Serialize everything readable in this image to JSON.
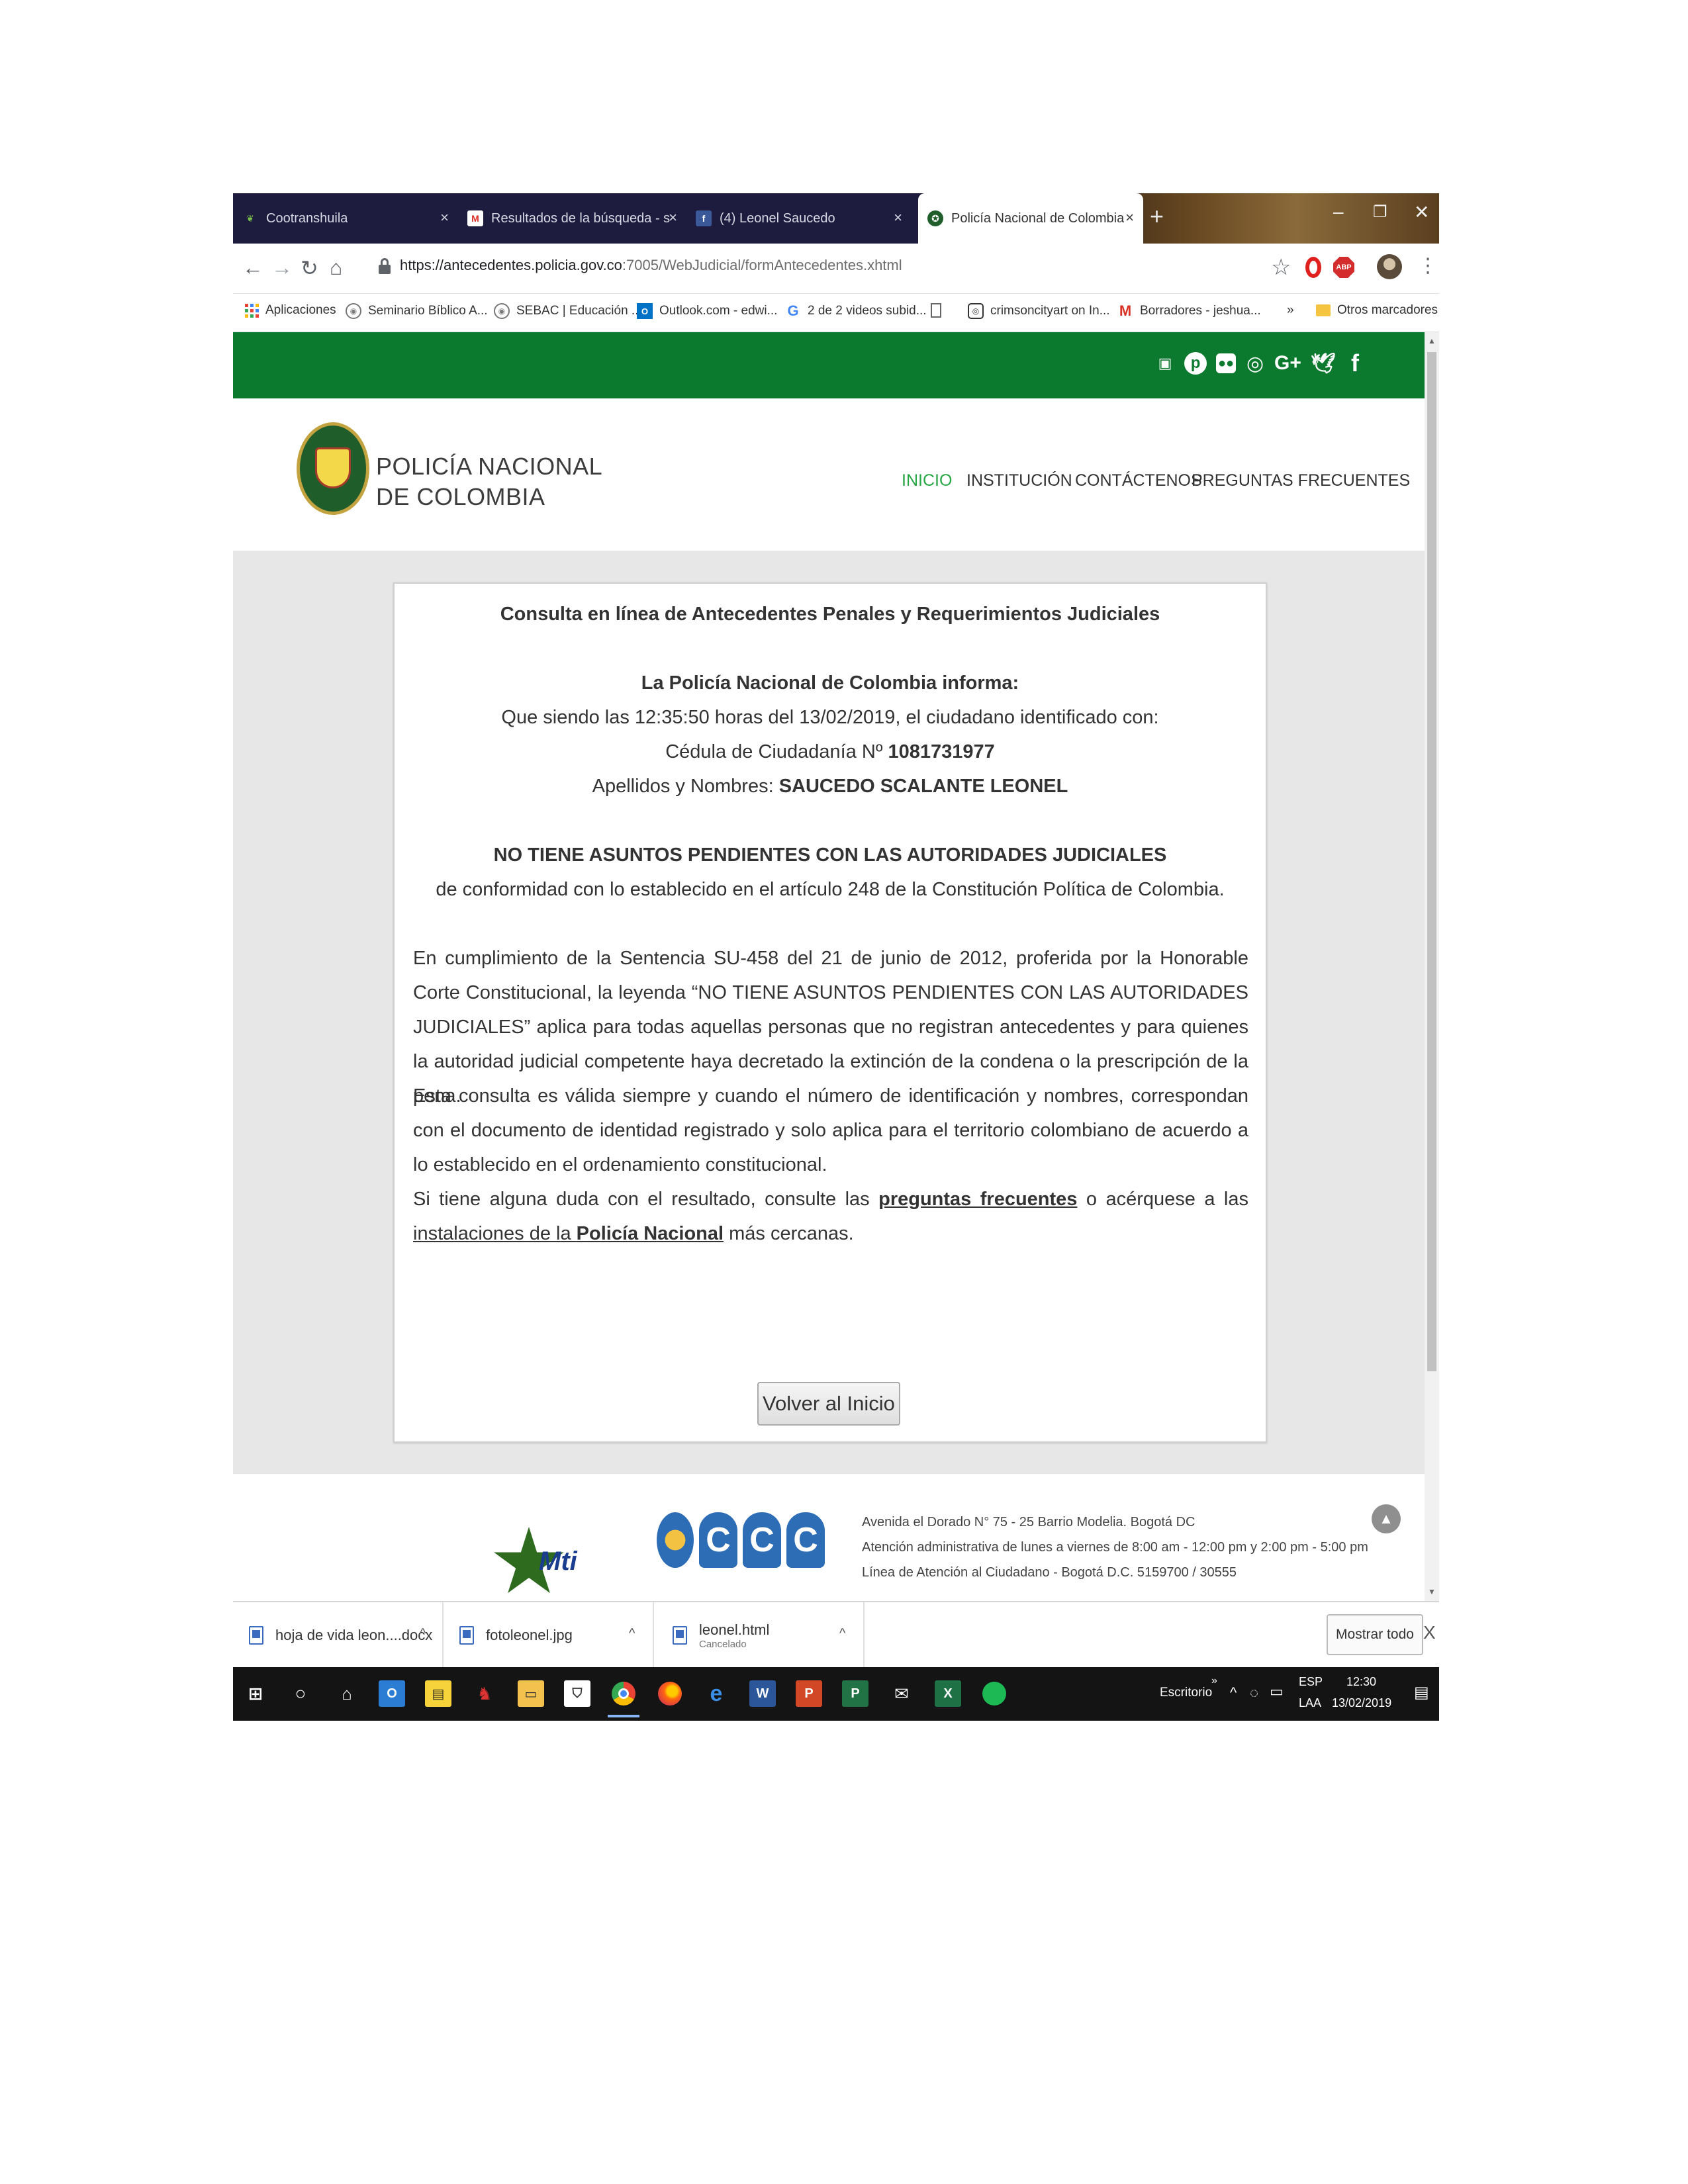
{
  "browser": {
    "tabs": [
      {
        "title": "Cootranshuila",
        "icon": "leaf-favicon-icon",
        "active": false
      },
      {
        "title": "Resultados de la búsqueda - sau",
        "icon": "gmail-favicon-icon",
        "active": false
      },
      {
        "title": "(4) Leonel Saucedo",
        "icon": "facebook-favicon-icon",
        "active": false
      },
      {
        "title": "Policía Nacional de Colombia",
        "icon": "police-favicon-icon",
        "active": true
      }
    ],
    "new_tab": "+",
    "url_host": "https://antecedentes.policia.gov.co",
    "url_path": ":7005/WebJudicial/formAntecedentes.xhtml",
    "bookmarks": [
      {
        "label": "Aplicaciones",
        "icon": "apps-grid-icon"
      },
      {
        "label": "Seminario Bíblico A...",
        "icon": "seminary-icon"
      },
      {
        "label": "SEBAC | Educación ...",
        "icon": "sebac-icon"
      },
      {
        "label": "Outlook.com - edwi...",
        "icon": "outlook-icon"
      },
      {
        "label": "2 de 2 videos subid...",
        "icon": "google-icon"
      },
      {
        "label": "",
        "icon": "page-icon"
      },
      {
        "label": "crimsoncityart on In...",
        "icon": "instagram-icon"
      },
      {
        "label": "Borradores - jeshua...",
        "icon": "gmail-icon"
      }
    ],
    "bookmarks_more": "»",
    "other_bookmarks": "Otros marcadores"
  },
  "site": {
    "brand_line1": "POLICÍA NACIONAL",
    "brand_line2": "DE COLOMBIA",
    "menu": [
      "INICIO",
      "INSTITUCIÓN",
      "CONTÁCTENOS",
      "PREGUNTAS FRECUENTES"
    ],
    "social_icons": [
      "youtube-icon",
      "pinterest-icon",
      "flickr-icon",
      "instagram-icon",
      "google-plus-icon",
      "twitter-icon",
      "facebook-icon"
    ]
  },
  "card": {
    "title": "Consulta en línea de Antecedentes Penales y Requerimientos Judiciales",
    "informa": "La Policía Nacional de Colombia informa:",
    "line_time": "Que siendo las 12:35:50 horas del 13/02/2019, el ciudadano identificado con:",
    "cedula_label": "Cédula de Ciudadanía Nº ",
    "cedula_value": "1081731977",
    "names_label": "Apellidos y Nombres: ",
    "names_value": "SAUCEDO SCALANTE LEONEL",
    "status": "NO TIENE ASUNTOS PENDIENTES CON LAS AUTORIDADES JUDICIALES",
    "status_ref": "de conformidad con lo establecido en el artículo 248 de la Constitución Política de Colombia.",
    "para1": "En cumplimiento de la Sentencia SU-458 del 21 de junio de 2012, proferida por la Honorable Corte Constitucional, la leyenda “NO TIENE ASUNTOS PENDIENTES CON LAS AUTORIDADES JUDICIALES” aplica para todas aquellas personas que no registran antecedentes y para quienes la autoridad judicial competente haya decretado la extinción de la condena o la prescripción de la pena.",
    "para2": "Esta consulta es válida siempre y cuando el número de identificación y nombres, correspondan con el documento de identidad registrado y solo aplica para el territorio colombiano de acuerdo a lo establecido en el ordenamiento constitucional.",
    "para3_a": "Si tiene alguna duda con el resultado, consulte las ",
    "para3_link1": "preguntas frecuentes",
    "para3_b": " o acérquese a las ",
    "para3_link2a": "instalaciones de la ",
    "para3_link2b": "Policía Nacional",
    "para3_c": " más cercanas.",
    "button": "Volver al Inicio"
  },
  "footer": {
    "logo1_text": "Mti",
    "logo2_text": "C",
    "address": "Avenida el Dorado N° 75 - 25 Barrio Modelia. Bogotá DC",
    "hours": "Atención administrativa de lunes a viernes de 8:00 am - 12:00 pm y 2:00 pm - 5:00 pm",
    "phone": "Línea de Atención al Ciudadano - Bogotá D.C. 5159700 / 30555"
  },
  "downloads": [
    {
      "name": "hoja de vida leon....docx",
      "status": ""
    },
    {
      "name": "fotoleonel.jpg",
      "status": ""
    },
    {
      "name": "leonel.html",
      "status": "Cancelado"
    }
  ],
  "downloads_show_all": "Mostrar todo",
  "downloads_close": "X",
  "taskbar": {
    "desktop_label": "Escritorio",
    "lang_top": "ESP",
    "lang_bottom": "LAA",
    "time": "12:30",
    "date": "13/02/2019"
  }
}
